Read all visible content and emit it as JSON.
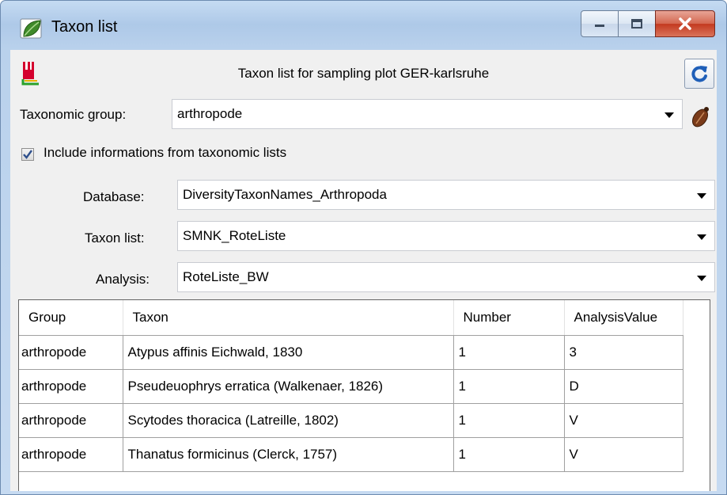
{
  "window": {
    "title": "Taxon list",
    "controls": {
      "minimize": "minimize-icon",
      "maximize": "maximize-icon",
      "close": "close-icon"
    }
  },
  "header": {
    "title": "Taxon list for sampling plot GER-karlsruhe"
  },
  "form": {
    "taxonomic_group": {
      "label": "Taxonomic group:",
      "value": "arthropode"
    },
    "include_checkbox": {
      "label": "Include informations from taxonomic lists",
      "checked": true
    },
    "database": {
      "label": "Database:",
      "value": "DiversityTaxonNames_Arthropoda"
    },
    "taxon_list": {
      "label": "Taxon list:",
      "value": "SMNK_RoteListe"
    },
    "analysis": {
      "label": "Analysis:",
      "value": "RoteListe_BW"
    }
  },
  "table": {
    "columns": [
      "Group",
      "Taxon",
      "Number",
      "AnalysisValue"
    ],
    "rows": [
      [
        "arthropode",
        "Atypus affinis Eichwald, 1830",
        "1",
        "3"
      ],
      [
        "arthropode",
        "Pseudeuophrys erratica (Walkenaer, 1826)",
        "1",
        "D"
      ],
      [
        "arthropode",
        "Scytodes thoracica (Latreille, 1802)",
        "1",
        "V"
      ],
      [
        "arthropode",
        "Thanatus formicinus (Clerck, 1757)",
        "1",
        "V"
      ]
    ]
  },
  "colors": {
    "title_bar": "#aec9e8",
    "client_background": "#f0f0f0",
    "close_button": "#c3391f",
    "refresh_icon": "#1f5fb8"
  }
}
